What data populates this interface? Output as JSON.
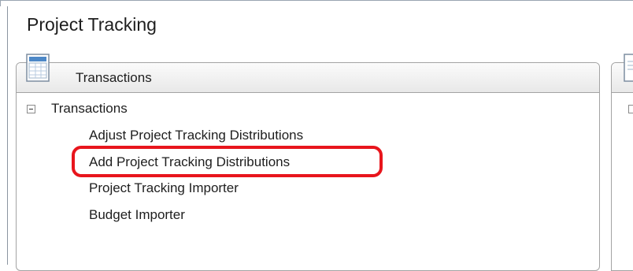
{
  "page": {
    "title": "Project Tracking"
  },
  "transactions_panel": {
    "header_label": "Transactions",
    "icon": "document-table-icon",
    "tree": {
      "root_label": "Transactions",
      "expanded": true,
      "items": [
        {
          "label": "Adjust Project Tracking Distributions",
          "highlighted": false
        },
        {
          "label": "Add Project Tracking Distributions",
          "highlighted": true
        },
        {
          "label": "Project Tracking Importer",
          "highlighted": false
        },
        {
          "label": "Budget Importer",
          "highlighted": false
        }
      ]
    }
  },
  "adjacent_panel": {
    "icon": "document-icon"
  },
  "colors": {
    "highlight": "#e8151c",
    "panel_border": "#a3a3a3",
    "text": "#1e1e1e"
  }
}
